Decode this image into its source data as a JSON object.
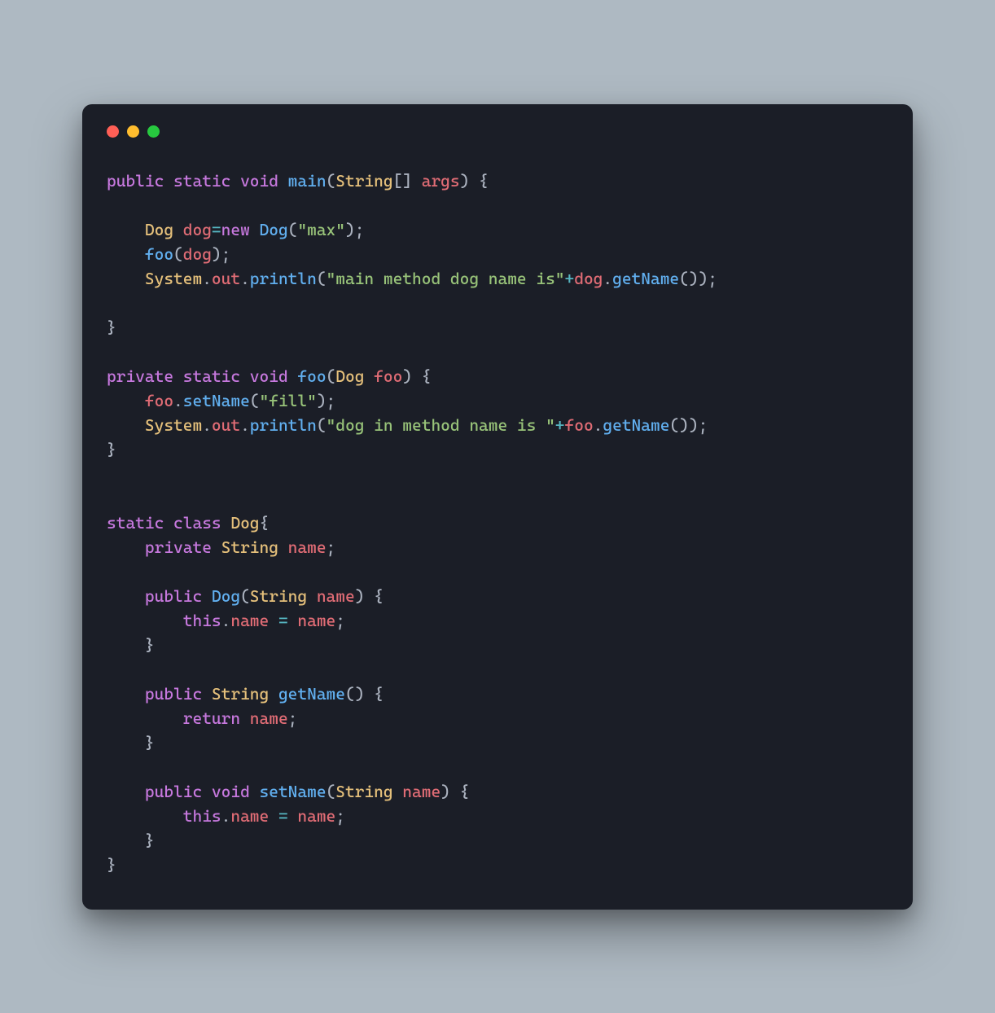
{
  "window": {
    "traffic_lights": [
      "red",
      "yellow",
      "green"
    ]
  },
  "code": {
    "language": "java",
    "tokens": [
      [
        [
          "kw",
          "public"
        ],
        [
          "pn",
          " "
        ],
        [
          "kw",
          "static"
        ],
        [
          "pn",
          " "
        ],
        [
          "kw",
          "void"
        ],
        [
          "pn",
          " "
        ],
        [
          "fn",
          "main"
        ],
        [
          "pn",
          "("
        ],
        [
          "type",
          "String"
        ],
        [
          "pn",
          "[] "
        ],
        [
          "var",
          "args"
        ],
        [
          "pn",
          ") {"
        ]
      ],
      [],
      [
        [
          "pn",
          "    "
        ],
        [
          "type",
          "Dog"
        ],
        [
          "pn",
          " "
        ],
        [
          "var",
          "dog"
        ],
        [
          "op",
          "="
        ],
        [
          "kw",
          "new"
        ],
        [
          "pn",
          " "
        ],
        [
          "fn",
          "Dog"
        ],
        [
          "pn",
          "("
        ],
        [
          "str",
          "\"max\""
        ],
        [
          "pn",
          ");"
        ]
      ],
      [
        [
          "pn",
          "    "
        ],
        [
          "fn",
          "foo"
        ],
        [
          "pn",
          "("
        ],
        [
          "var",
          "dog"
        ],
        [
          "pn",
          ");"
        ]
      ],
      [
        [
          "pn",
          "    "
        ],
        [
          "type",
          "System"
        ],
        [
          "pn",
          "."
        ],
        [
          "var",
          "out"
        ],
        [
          "pn",
          "."
        ],
        [
          "fn",
          "println"
        ],
        [
          "pn",
          "("
        ],
        [
          "str",
          "\"main method dog name is\""
        ],
        [
          "op",
          "+"
        ],
        [
          "var",
          "dog"
        ],
        [
          "pn",
          "."
        ],
        [
          "fn",
          "getName"
        ],
        [
          "pn",
          "());"
        ]
      ],
      [],
      [
        [
          "pn",
          "}"
        ]
      ],
      [],
      [
        [
          "kw",
          "private"
        ],
        [
          "pn",
          " "
        ],
        [
          "kw",
          "static"
        ],
        [
          "pn",
          " "
        ],
        [
          "kw",
          "void"
        ],
        [
          "pn",
          " "
        ],
        [
          "fn",
          "foo"
        ],
        [
          "pn",
          "("
        ],
        [
          "type",
          "Dog"
        ],
        [
          "pn",
          " "
        ],
        [
          "var",
          "foo"
        ],
        [
          "pn",
          ") {"
        ]
      ],
      [
        [
          "pn",
          "    "
        ],
        [
          "var",
          "foo"
        ],
        [
          "pn",
          "."
        ],
        [
          "fn",
          "setName"
        ],
        [
          "pn",
          "("
        ],
        [
          "str",
          "\"fill\""
        ],
        [
          "pn",
          ");"
        ]
      ],
      [
        [
          "pn",
          "    "
        ],
        [
          "type",
          "System"
        ],
        [
          "pn",
          "."
        ],
        [
          "var",
          "out"
        ],
        [
          "pn",
          "."
        ],
        [
          "fn",
          "println"
        ],
        [
          "pn",
          "("
        ],
        [
          "str",
          "\"dog in method name is \""
        ],
        [
          "op",
          "+"
        ],
        [
          "var",
          "foo"
        ],
        [
          "pn",
          "."
        ],
        [
          "fn",
          "getName"
        ],
        [
          "pn",
          "());"
        ]
      ],
      [
        [
          "pn",
          "}"
        ]
      ],
      [],
      [],
      [
        [
          "kw",
          "static"
        ],
        [
          "pn",
          " "
        ],
        [
          "kw",
          "class"
        ],
        [
          "pn",
          " "
        ],
        [
          "type",
          "Dog"
        ],
        [
          "pn",
          "{"
        ]
      ],
      [
        [
          "pn",
          "    "
        ],
        [
          "kw",
          "private"
        ],
        [
          "pn",
          " "
        ],
        [
          "type",
          "String"
        ],
        [
          "pn",
          " "
        ],
        [
          "var",
          "name"
        ],
        [
          "pn",
          ";"
        ]
      ],
      [],
      [
        [
          "pn",
          "    "
        ],
        [
          "kw",
          "public"
        ],
        [
          "pn",
          " "
        ],
        [
          "fn",
          "Dog"
        ],
        [
          "pn",
          "("
        ],
        [
          "type",
          "String"
        ],
        [
          "pn",
          " "
        ],
        [
          "var",
          "name"
        ],
        [
          "pn",
          ") {"
        ]
      ],
      [
        [
          "pn",
          "        "
        ],
        [
          "kw",
          "this"
        ],
        [
          "pn",
          "."
        ],
        [
          "var",
          "name"
        ],
        [
          "pn",
          " "
        ],
        [
          "op",
          "="
        ],
        [
          "pn",
          " "
        ],
        [
          "var",
          "name"
        ],
        [
          "pn",
          ";"
        ]
      ],
      [
        [
          "pn",
          "    }"
        ]
      ],
      [],
      [
        [
          "pn",
          "    "
        ],
        [
          "kw",
          "public"
        ],
        [
          "pn",
          " "
        ],
        [
          "type",
          "String"
        ],
        [
          "pn",
          " "
        ],
        [
          "fn",
          "getName"
        ],
        [
          "pn",
          "() {"
        ]
      ],
      [
        [
          "pn",
          "        "
        ],
        [
          "kw",
          "return"
        ],
        [
          "pn",
          " "
        ],
        [
          "var",
          "name"
        ],
        [
          "pn",
          ";"
        ]
      ],
      [
        [
          "pn",
          "    }"
        ]
      ],
      [],
      [
        [
          "pn",
          "    "
        ],
        [
          "kw",
          "public"
        ],
        [
          "pn",
          " "
        ],
        [
          "kw",
          "void"
        ],
        [
          "pn",
          " "
        ],
        [
          "fn",
          "setName"
        ],
        [
          "pn",
          "("
        ],
        [
          "type",
          "String"
        ],
        [
          "pn",
          " "
        ],
        [
          "var",
          "name"
        ],
        [
          "pn",
          ") {"
        ]
      ],
      [
        [
          "pn",
          "        "
        ],
        [
          "kw",
          "this"
        ],
        [
          "pn",
          "."
        ],
        [
          "var",
          "name"
        ],
        [
          "pn",
          " "
        ],
        [
          "op",
          "="
        ],
        [
          "pn",
          " "
        ],
        [
          "var",
          "name"
        ],
        [
          "pn",
          ";"
        ]
      ],
      [
        [
          "pn",
          "    }"
        ]
      ],
      [
        [
          "pn",
          "}"
        ]
      ]
    ]
  }
}
